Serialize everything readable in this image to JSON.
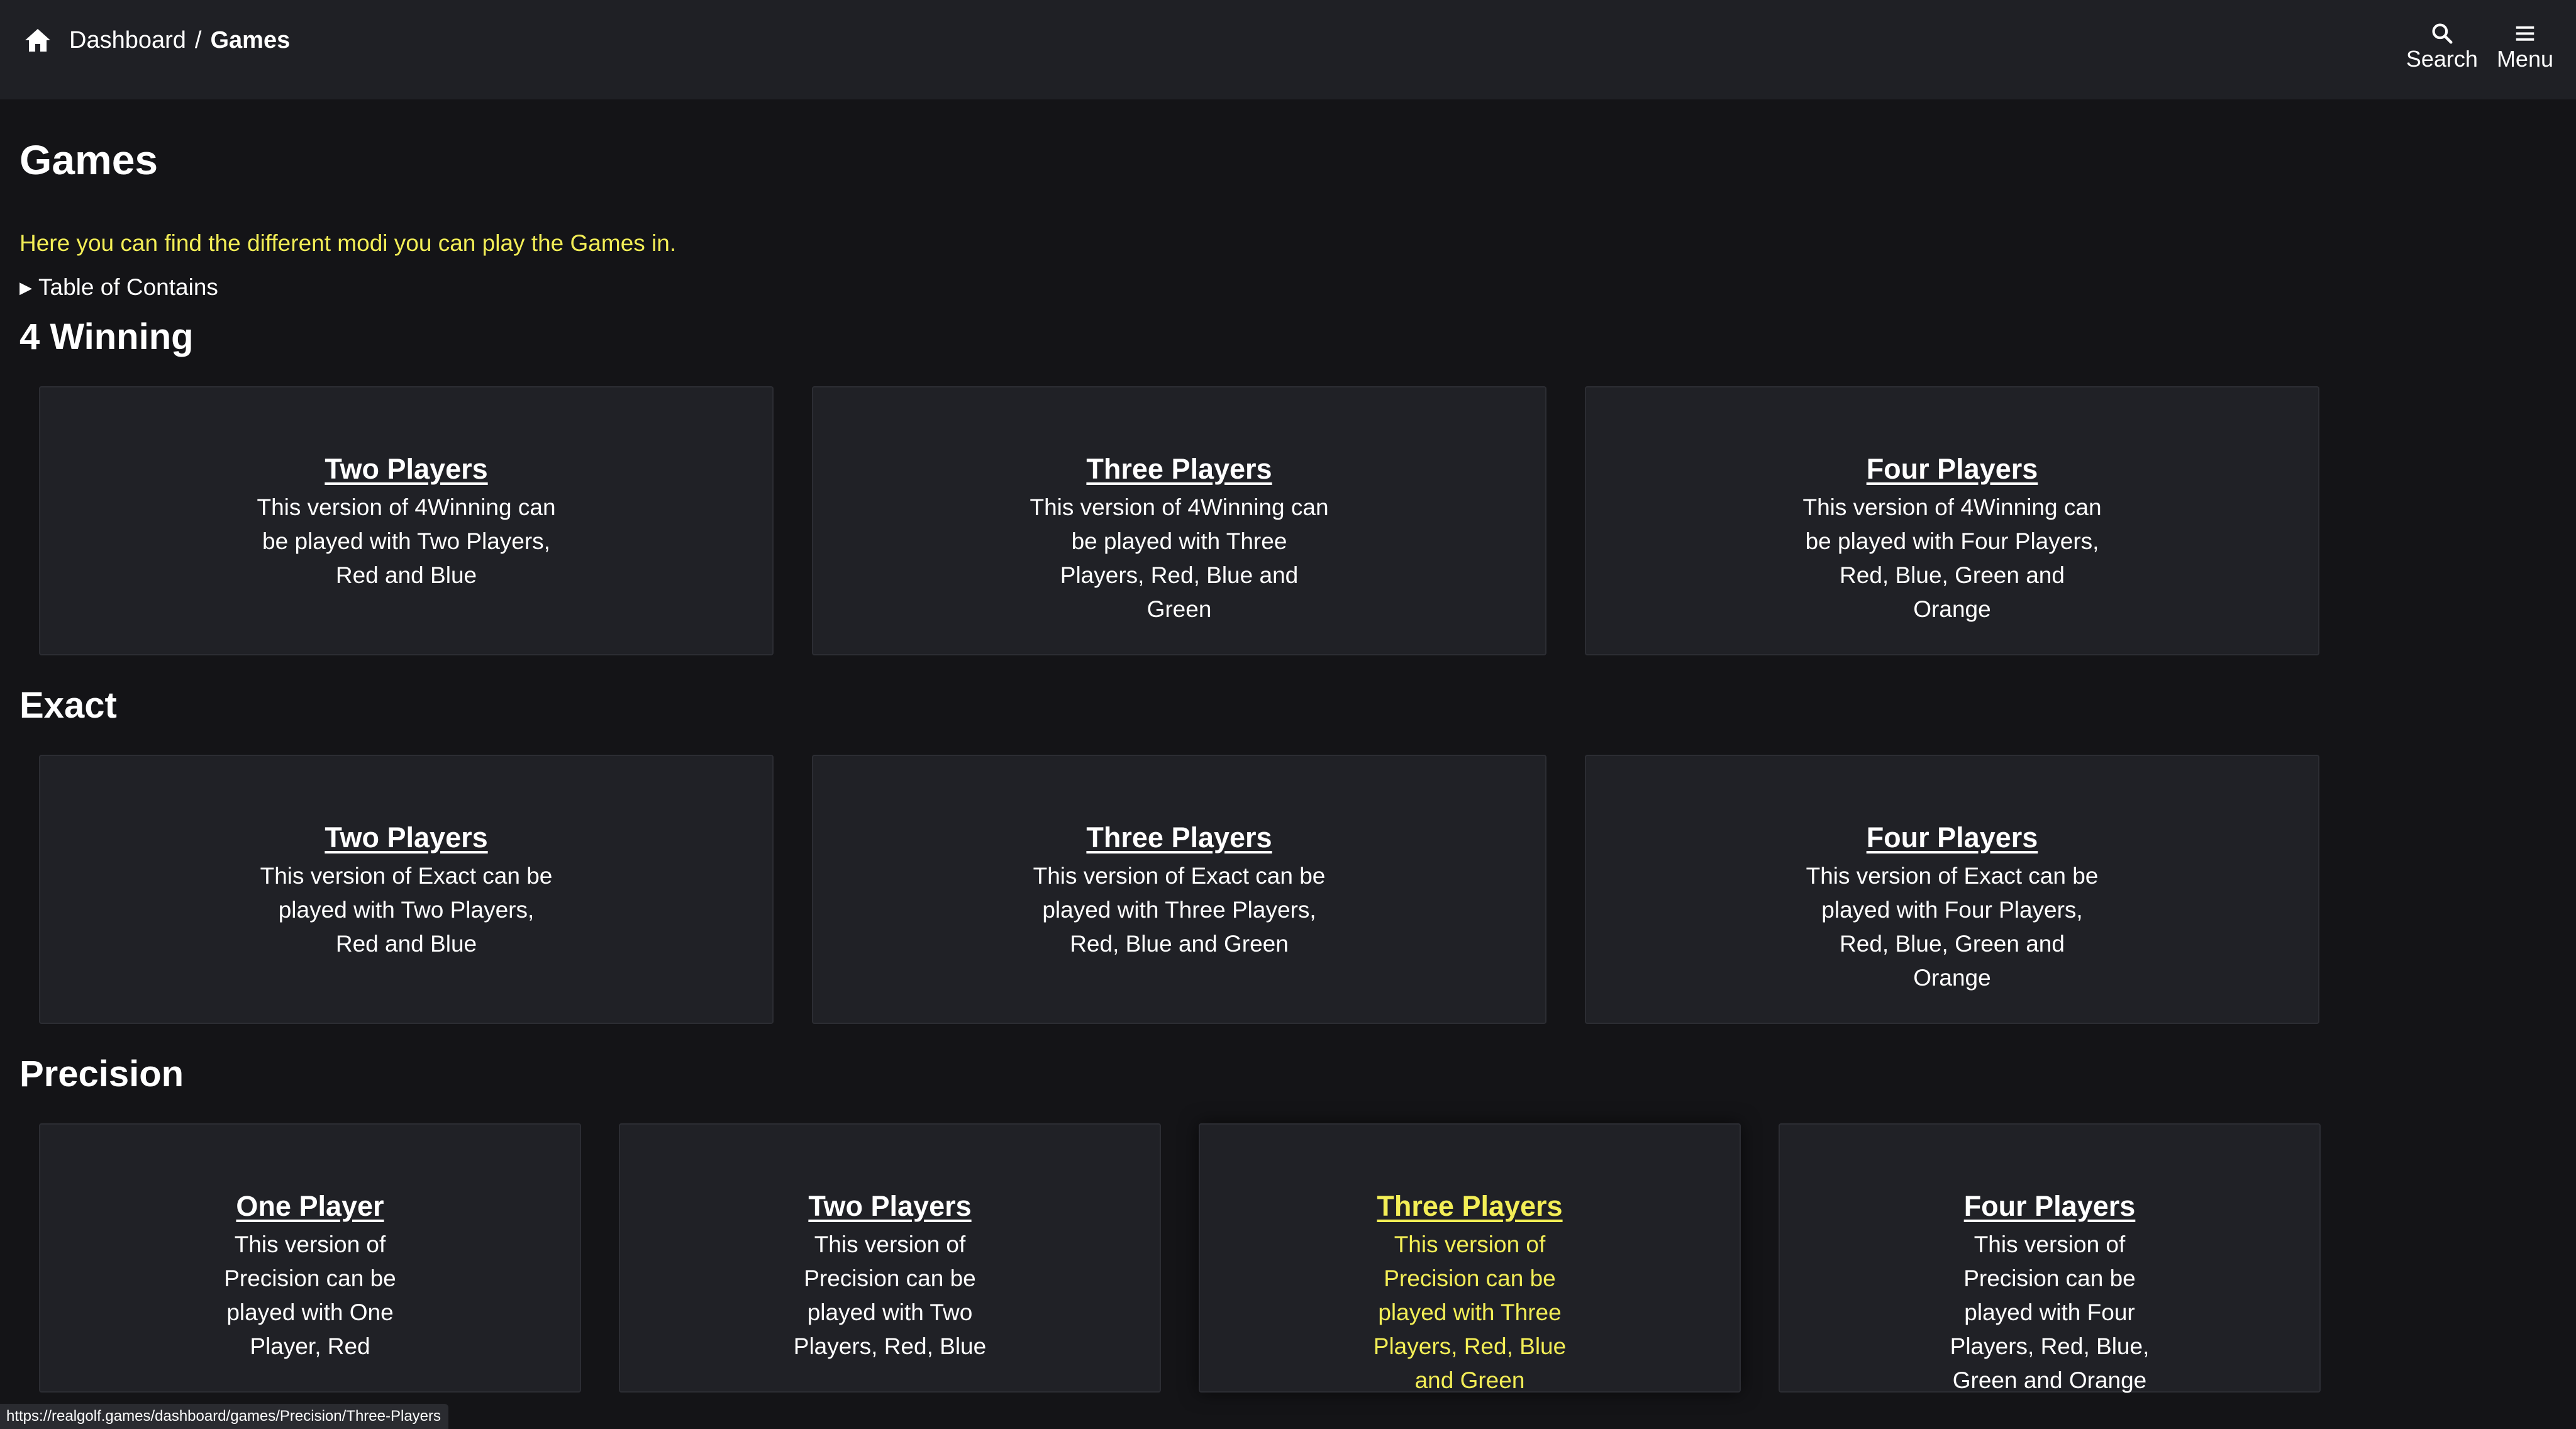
{
  "header": {
    "breadcrumb": {
      "home": "Dashboard",
      "separator": "/",
      "current": "Games"
    },
    "actions": {
      "search": "Search",
      "menu": "Menu"
    }
  },
  "page": {
    "title": "Games",
    "intro": "Here you can find the different modi you can play the Games in.",
    "toc": "Table of Contains"
  },
  "sections": [
    {
      "title": "4 Winning",
      "cards": [
        {
          "title": "Two Players",
          "desc": "This version of 4Winning can be played with Two Players, Red and Blue"
        },
        {
          "title": "Three Players",
          "desc": "This version of 4Winning can be played with Three Players, Red, Blue and Green"
        },
        {
          "title": "Four Players",
          "desc": "This version of 4Winning can be played with Four Players, Red, Blue, Green and Orange"
        }
      ]
    },
    {
      "title": "Exact",
      "cards": [
        {
          "title": "Two Players",
          "desc": "This version of Exact can be played with Two Players, Red and Blue"
        },
        {
          "title": "Three Players",
          "desc": "This version of Exact can be played with Three Players, Red, Blue and Green"
        },
        {
          "title": "Four Players",
          "desc": "This version of Exact can be played with Four Players, Red, Blue, Green and Orange"
        }
      ]
    },
    {
      "title": "Precision",
      "cards": [
        {
          "title": "One Player",
          "desc": "This version of Precision can be played with One Player, Red"
        },
        {
          "title": "Two Players",
          "desc": "This version of Precision can be played with Two Players, Red, Blue"
        },
        {
          "title": "Three Players",
          "desc": "This version of Precision can be played with Three Players, Red, Blue and Green"
        },
        {
          "title": "Four Players",
          "desc": "This version of Precision can be played with Four Players, Red, Blue, Green and Orange"
        }
      ]
    }
  ],
  "status_bar": {
    "url": "https://realgolf.games/dashboard/games/Precision/Three-Players"
  },
  "colors": {
    "accent": "#f3ee56",
    "background": "#141417",
    "header": "#1f2025",
    "card": "#202126"
  },
  "icons": {
    "home": "home-icon",
    "search": "search-icon",
    "menu": "menu-icon",
    "toc": "triangle-right-icon"
  }
}
